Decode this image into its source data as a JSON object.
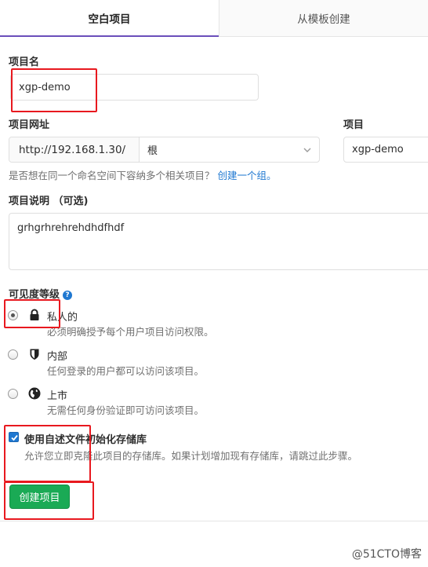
{
  "tabs": [
    {
      "label": "空白项目"
    },
    {
      "label": "从模板创建"
    }
  ],
  "project_name": {
    "label": "项目名",
    "value": "xgp-demo"
  },
  "project_url": {
    "label": "项目网址",
    "prefix": "http://192.168.1.30/",
    "namespace": "根"
  },
  "project_slug": {
    "label": "项目",
    "value": "xgp-demo"
  },
  "hint": {
    "text": "是否想在同一个命名空间下容纳多个相关项目？",
    "link": "创建一个组。"
  },
  "description": {
    "label": "项目说明 （可选)",
    "value": "grhgrhrehrehdhdfhdf"
  },
  "visibility": {
    "label": "可见度等级",
    "help_icon": "?",
    "options": [
      {
        "title": "私人的",
        "desc": "必须明确授予每个用户项目访问权限。",
        "icon": "lock-icon",
        "checked": true
      },
      {
        "title": "内部",
        "desc": "任何登录的用户都可以访问该项目。",
        "icon": "shield-icon",
        "checked": false
      },
      {
        "title": "上市",
        "desc": "无需任何身份验证即可访问该项目。",
        "icon": "globe-icon",
        "checked": false
      }
    ]
  },
  "readme": {
    "label": "使用自述文件初始化存储库",
    "desc": "允许您立即克隆此项目的存储库。如果计划增加现有存储库，请跳过此步骤。",
    "checked": true
  },
  "submit": {
    "label": "创建项目"
  },
  "watermark": "@51CTO博客",
  "colors": {
    "accent": "#1f78d1",
    "success": "#1aaa55",
    "tab_active": "#6b4fbb",
    "annotation": "#e8191f"
  }
}
